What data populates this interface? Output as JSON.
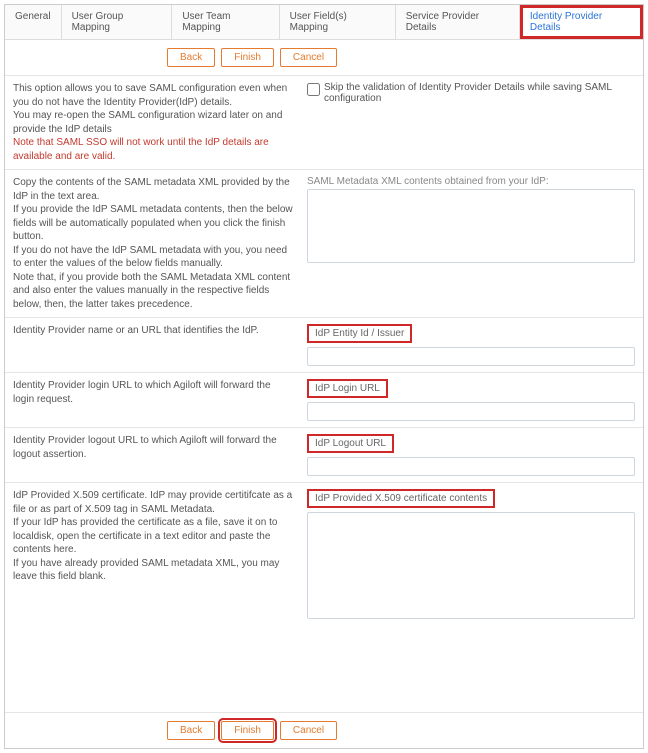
{
  "tabs": {
    "t0": "General",
    "t1": "User Group Mapping",
    "t2": "User Team Mapping",
    "t3": "User Field(s) Mapping",
    "t4": "Service Provider Details",
    "t5": "Identity Provider Details"
  },
  "buttons": {
    "back": "Back",
    "finish": "Finish",
    "cancel": "Cancel"
  },
  "intro": {
    "p1": "This option allows you to save SAML configuration even when you do not have the Identity Provider(IdP) details.",
    "p2": "You may re-open the SAML configuration wizard later on and provide the IdP details",
    "warn": "Note that SAML SSO will not work until the IdP details are available and are valid.",
    "skip": "Skip the validation of Identity Provider Details while saving SAML configuration"
  },
  "meta": {
    "l1": "Copy the contents of the SAML metadata XML provided by the IdP in the text area.",
    "l2": "If you provide the IdP SAML metadata contents, then the below fields will be automatically populated when you click the finish button.",
    "l3": "If you do not have the IdP SAML metadata with you, you need to enter the values of the below fields manually.",
    "l4": "Note that, if you provide both the SAML Metadata XML content and also enter the values manually in the respective fields below, then, the latter takes precedence.",
    "label": "SAML Metadata XML contents obtained from your IdP:"
  },
  "fields": {
    "entity_desc": "Identity Provider name or an URL that identifies the IdP.",
    "entity_label": "IdP Entity Id / Issuer",
    "login_desc": "Identity Provider login URL to which Agiloft will forward the login request.",
    "login_label": "IdP Login URL",
    "logout_desc": "Identity Provider logout URL to which Agiloft will forward the logout assertion.",
    "logout_label": "IdP Logout URL",
    "cert_d1": "IdP Provided X.509 certificate. IdP may provide certitifcate as a file or as part of X.509 tag in SAML Metadata.",
    "cert_d2": "If your IdP has provided the certificate as a file, save it on to localdisk, open the certificate in a text editor and paste the contents here.",
    "cert_d3": "If you have already provided SAML metadata XML, you may leave this field blank.",
    "cert_label": "IdP Provided X.509 certificate contents"
  }
}
